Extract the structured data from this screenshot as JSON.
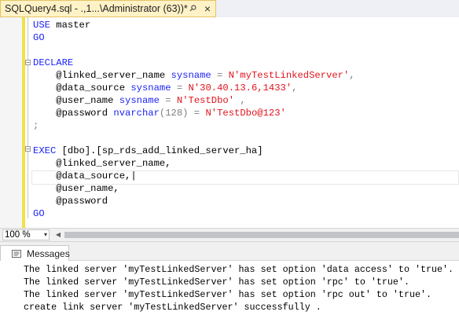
{
  "tab": {
    "title": "SQLQuery4.sql - .,1...\\Administrator (63))*",
    "pin_icon": "pin-icon",
    "close_icon": "close-icon"
  },
  "editor": {
    "lines": [
      {
        "t1": "USE",
        "t2": " master"
      },
      {
        "t1": "GO"
      },
      {
        "t1": ""
      },
      {
        "t1": "DECLARE"
      },
      {
        "t1": "    @linked_server_name ",
        "t2": "sysname",
        "t3": " = ",
        "t4": "N'myTestLinkedServer'",
        "t5": ","
      },
      {
        "t1": "    @data_source ",
        "t2": "sysname",
        "t3": " = ",
        "t4": "N'30.40.13.6,1433'",
        "t5": ","
      },
      {
        "t1": "    @user_name ",
        "t2": "sysname",
        "t3": " = ",
        "t4": "N'TestDbo'",
        "t5": " ,"
      },
      {
        "t1": "    @password ",
        "t2": "nvarchar",
        "t3": "(128) = ",
        "t4": "N'TestDbo@123'"
      },
      {
        "t1": ";"
      },
      {
        "t1": ""
      },
      {
        "t1": "EXEC",
        "t2": " [dbo].[sp_rds_add_linked_server_ha]"
      },
      {
        "t1": "    @linked_server_name,"
      },
      {
        "t1": "    @data_source,"
      },
      {
        "t1": "    @user_name,"
      },
      {
        "t1": "    @password"
      },
      {
        "t1": "GO"
      }
    ]
  },
  "status": {
    "zoom": "100 %",
    "zoom_arrow": "▾"
  },
  "results": {
    "tab_label": "Messages",
    "messages": [
      "The linked server 'myTestLinkedServer' has set option 'data access' to 'true'.",
      "The linked server 'myTestLinkedServer' has set option 'rpc' to 'true'.",
      "The linked server 'myTestLinkedServer' has set option 'rpc out' to 'true'.",
      "create link server 'myTestLinkedServer' successfully ."
    ]
  }
}
